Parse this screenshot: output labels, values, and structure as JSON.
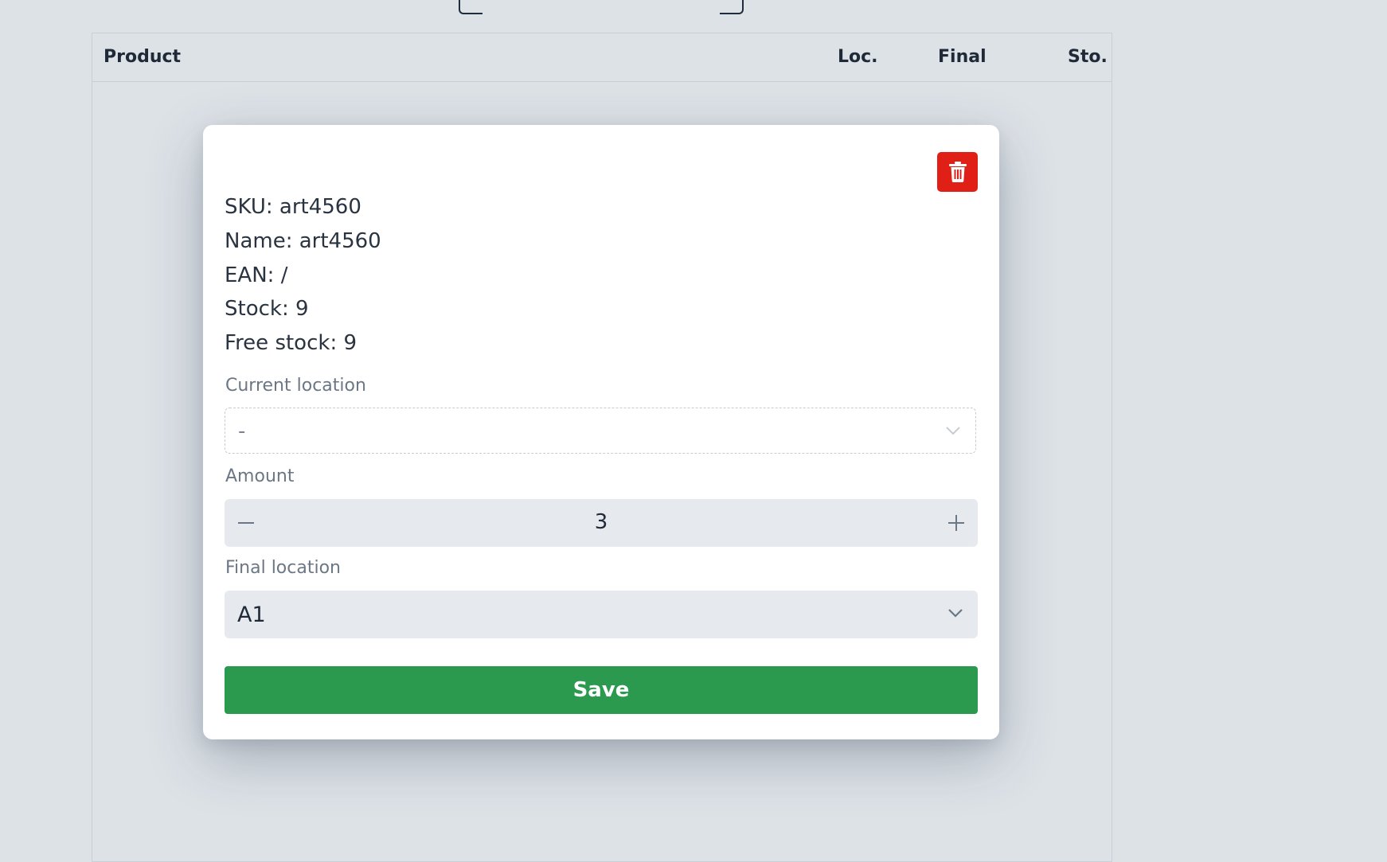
{
  "scanner": {
    "code_text": "",
    "colors": {
      "frame": "#1f2d3d"
    }
  },
  "table": {
    "columns": [
      "Product",
      "Loc.",
      "Final",
      "Sto."
    ]
  },
  "modal": {
    "delete_icon": "trash-icon",
    "sku_line": "SKU: art4560",
    "name_line": "Name: art4560",
    "ean_line": "EAN: /",
    "stock_line": "Stock: 9",
    "free_stock_line": "Free stock: 9",
    "current_location": {
      "label": "Current location",
      "value": "-"
    },
    "amount": {
      "label": "Amount",
      "value": "3",
      "decrement_icon": "minus-icon",
      "increment_icon": "plus-icon"
    },
    "final_location": {
      "label": "Final location",
      "value": "A1"
    },
    "save_label": "Save"
  },
  "colors": {
    "background": "#dde2e7",
    "danger": "#e02016",
    "success": "#2b9a4e",
    "input_bg": "#e6e9ed"
  }
}
